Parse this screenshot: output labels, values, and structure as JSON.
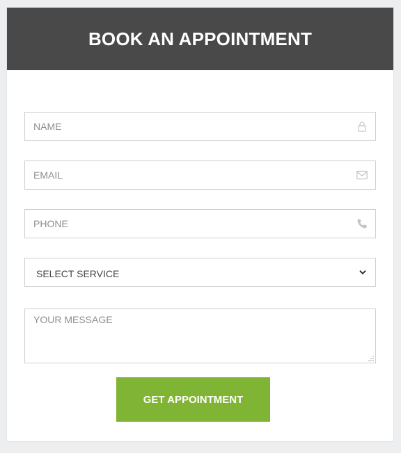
{
  "form": {
    "title": "BOOK AN APPOINTMENT",
    "name": {
      "placeholder": "NAME",
      "icon": "user-icon"
    },
    "email": {
      "placeholder": "EMAIL",
      "icon": "envelope-icon"
    },
    "phone": {
      "placeholder": "PHONE",
      "icon": "phone-icon"
    },
    "service": {
      "selected": "SELECT SERVICE",
      "icon": "chevron-down-icon"
    },
    "message": {
      "placeholder": "YOUR MESSAGE"
    },
    "submit_label": "GET APPOINTMENT"
  },
  "colors": {
    "header_bg": "#494949",
    "button_bg": "#80b435",
    "page_bg": "#eceeef",
    "border": "#cfcfcf"
  }
}
